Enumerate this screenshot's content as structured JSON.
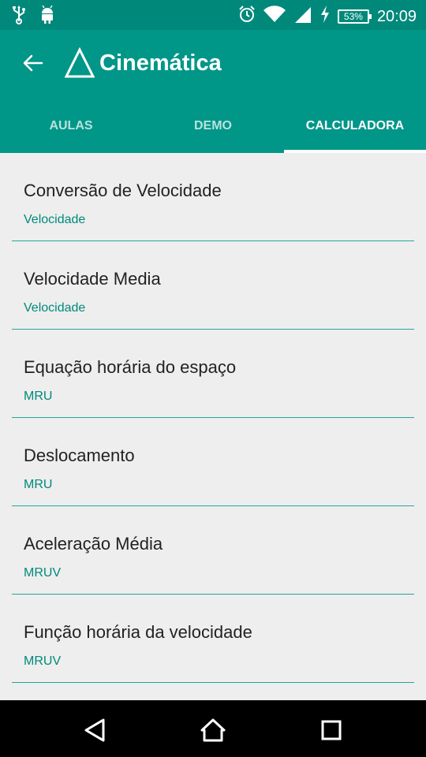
{
  "status_bar": {
    "battery": "53%",
    "time": "20:09",
    "icons": [
      "usb-icon",
      "android-icon",
      "alarm-icon",
      "wifi-icon",
      "signal-icon",
      "charging-icon"
    ]
  },
  "app_bar": {
    "title": "Cinemática",
    "logo": "triangle-logo",
    "color": "#009688"
  },
  "tabs": [
    {
      "label": "AULAS",
      "active": false
    },
    {
      "label": "DEMO",
      "active": false
    },
    {
      "label": "CALCULADORA",
      "active": true
    }
  ],
  "items": [
    {
      "title": "Conversão de Velocidade",
      "subtitle": "Velocidade"
    },
    {
      "title": "Velocidade Media",
      "subtitle": "Velocidade"
    },
    {
      "title": "Equação horária do espaço",
      "subtitle": "MRU"
    },
    {
      "title": "Deslocamento",
      "subtitle": "MRU"
    },
    {
      "title": "Aceleração Média",
      "subtitle": "MRUV"
    },
    {
      "title": "Função horária da velocidade",
      "subtitle": "MRUV"
    }
  ],
  "nav_bar": {
    "icons": [
      "back-triangle-icon",
      "home-icon",
      "recents-icon"
    ]
  }
}
